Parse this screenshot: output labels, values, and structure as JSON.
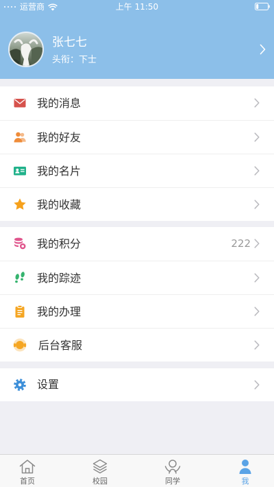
{
  "theme": {
    "header_bg": "#8cbfe9",
    "page_bg": "#efeff4",
    "tab_active": "#5aa3e6",
    "tab_inactive": "#8a8a8a"
  },
  "status_bar": {
    "signal_icon": "signal-dots-icon",
    "carrier": "运营商",
    "wifi_icon": "wifi-icon",
    "time": "上午 11:50",
    "battery_icon": "battery-icon",
    "battery_level": 0.2
  },
  "profile": {
    "name": "张七七",
    "title": "头衔：下士",
    "chevron_icon": "chevron-right-icon"
  },
  "menu": {
    "group1": [
      {
        "label": "我的消息",
        "icon": "envelope-icon",
        "icon_color": "#d6524c"
      },
      {
        "label": "我的好友",
        "icon": "friends-icon",
        "icon_color": "#ef8c3a"
      },
      {
        "label": "我的名片",
        "icon": "business-card-icon",
        "icon_color": "#22b28b"
      },
      {
        "label": "我的收藏",
        "icon": "star-icon",
        "icon_color": "#f6a11c"
      }
    ],
    "group2": [
      {
        "label": "我的积分",
        "icon": "points-icon",
        "icon_color": "#e0568d",
        "value": "222"
      },
      {
        "label": "我的踪迹",
        "icon": "footprints-icon",
        "icon_color": "#36b46f"
      },
      {
        "label": "我的办理",
        "icon": "clipboard-icon",
        "icon_color": "#f5a623"
      },
      {
        "label": "后台客服",
        "icon": "headset-icon",
        "icon_color": "#f5a623"
      }
    ],
    "group3": [
      {
        "label": "设置",
        "icon": "gear-icon",
        "icon_color": "#3d8fd9"
      }
    ]
  },
  "tab_bar": {
    "items": [
      {
        "label": "首页",
        "icon": "home-icon",
        "active": false
      },
      {
        "label": "校园",
        "icon": "layers-icon",
        "active": false
      },
      {
        "label": "同学",
        "icon": "classmates-icon",
        "active": false
      },
      {
        "label": "我",
        "icon": "profile-icon",
        "active": true
      }
    ]
  }
}
